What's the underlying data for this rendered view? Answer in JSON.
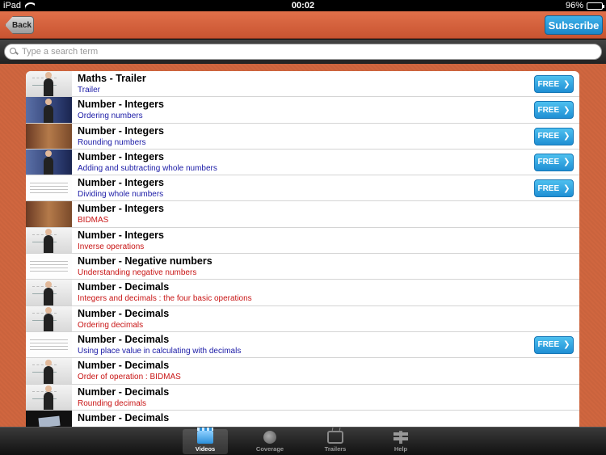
{
  "status": {
    "device": "iPad",
    "time": "00:02",
    "battery": "96%",
    "battery_level": 0.96
  },
  "nav": {
    "back_label": "Back",
    "subscribe_label": "Subscribe"
  },
  "search": {
    "placeholder": "Type a search term",
    "value": ""
  },
  "colors": {
    "background": "#d0663f",
    "free_button": "#1f8fd4",
    "subtitle_blue": "#1a1aa6",
    "subtitle_red": "#c81414"
  },
  "list": {
    "free_label": "FREE",
    "items": [
      {
        "title": "Maths - Trailer",
        "subtitle": "Trailer",
        "subtitle_color": "blue",
        "free": true,
        "thumb": "board"
      },
      {
        "title": "Number - Integers",
        "subtitle": "Ordering numbers",
        "subtitle_color": "blue",
        "free": true,
        "thumb": "person"
      },
      {
        "title": "Number - Integers",
        "subtitle": "Rounding numbers",
        "subtitle_color": "blue",
        "free": true,
        "thumb": "room"
      },
      {
        "title": "Number - Integers",
        "subtitle": "Adding and subtracting whole numbers",
        "subtitle_color": "blue",
        "free": true,
        "thumb": "person"
      },
      {
        "title": "Number - Integers",
        "subtitle": "Dividing whole numbers",
        "subtitle_color": "blue",
        "free": true,
        "thumb": "paper"
      },
      {
        "title": "Number - Integers",
        "subtitle": "BIDMAS",
        "subtitle_color": "red",
        "free": false,
        "thumb": "room"
      },
      {
        "title": "Number - Integers",
        "subtitle": "Inverse operations",
        "subtitle_color": "red",
        "free": false,
        "thumb": "board"
      },
      {
        "title": "Number - Negative numbers",
        "subtitle": "Understanding negative numbers",
        "subtitle_color": "red",
        "free": false,
        "thumb": "paper"
      },
      {
        "title": "Number - Decimals",
        "subtitle": "Integers and decimals : the four basic operations",
        "subtitle_color": "red",
        "free": false,
        "thumb": "board"
      },
      {
        "title": "Number - Decimals",
        "subtitle": "Ordering decimals",
        "subtitle_color": "red",
        "free": false,
        "thumb": "board"
      },
      {
        "title": "Number - Decimals",
        "subtitle": "Using place value in calculating with decimals",
        "subtitle_color": "blue",
        "free": true,
        "thumb": "paper"
      },
      {
        "title": "Number - Decimals",
        "subtitle": "Order of operation : BIDMAS",
        "subtitle_color": "red",
        "free": false,
        "thumb": "board"
      },
      {
        "title": "Number - Decimals",
        "subtitle": "Rounding decimals",
        "subtitle_color": "red",
        "free": false,
        "thumb": "board"
      },
      {
        "title": "Number - Decimals",
        "subtitle": "",
        "subtitle_color": "red",
        "free": false,
        "thumb": "dark"
      }
    ]
  },
  "tabs": [
    {
      "label": "Videos",
      "icon": "video-icon",
      "active": true
    },
    {
      "label": "Coverage",
      "icon": "globe-icon",
      "active": false
    },
    {
      "label": "Trailers",
      "icon": "tv-icon",
      "active": false
    },
    {
      "label": "Help",
      "icon": "signpost-icon",
      "active": false
    }
  ]
}
